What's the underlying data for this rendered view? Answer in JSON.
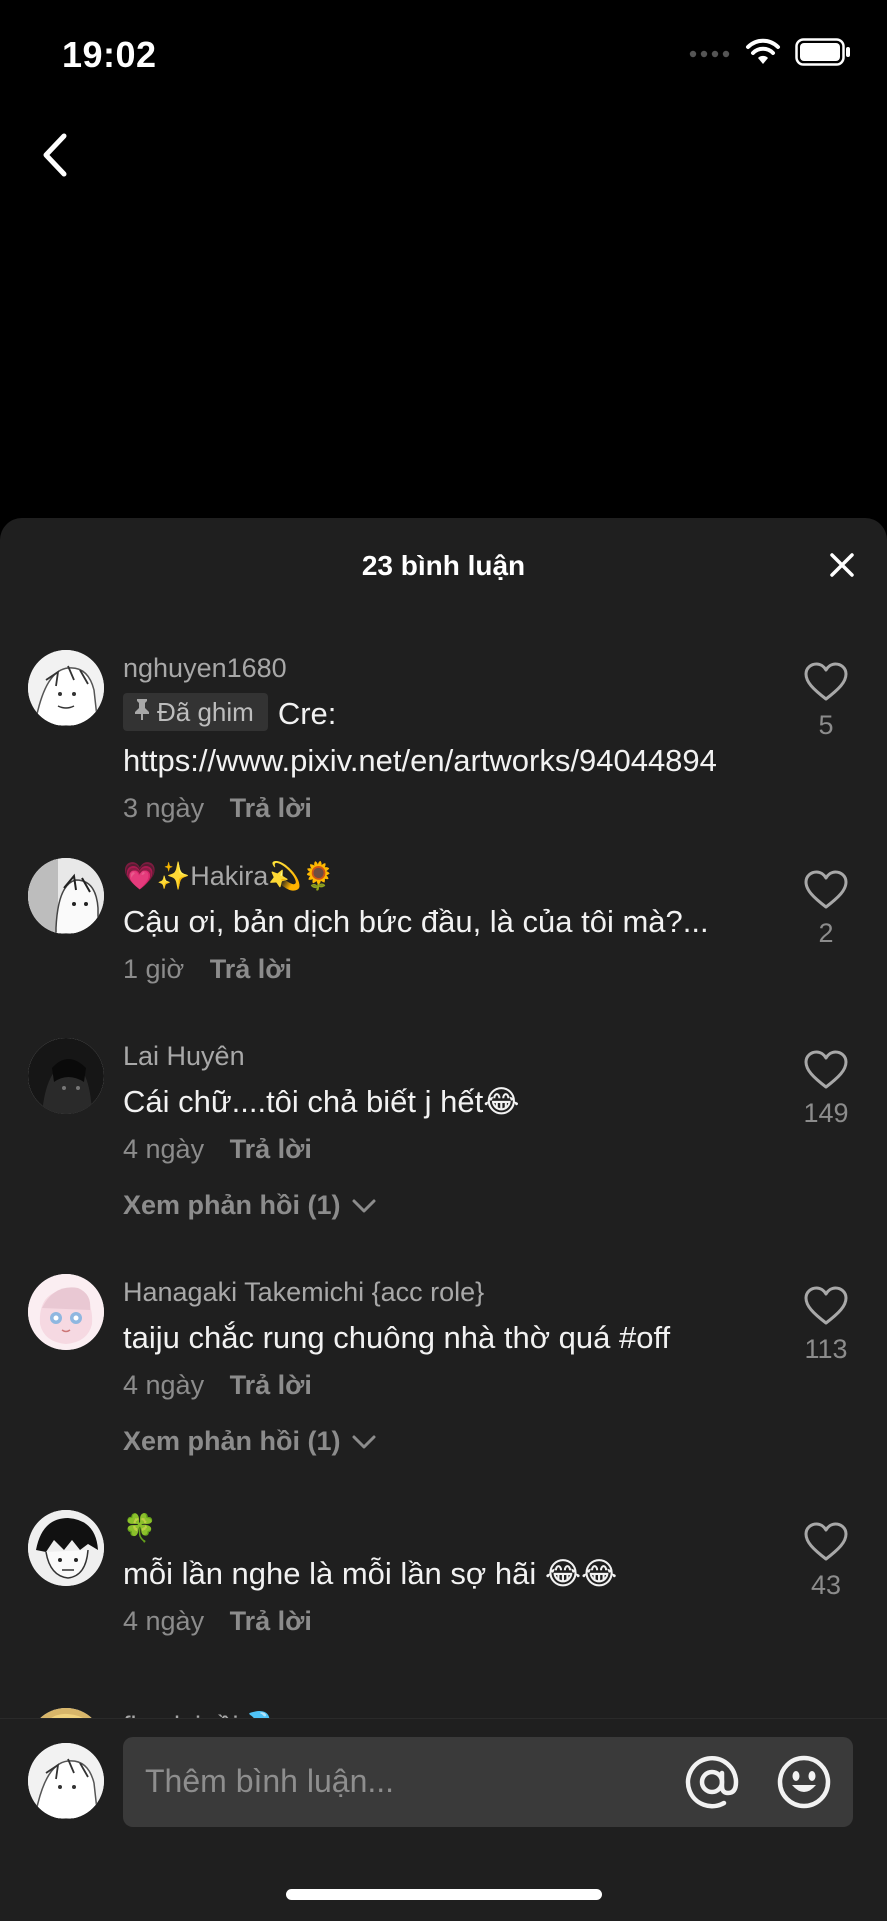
{
  "status": {
    "time": "19:02",
    "icons": [
      "signal-icon",
      "wifi-icon",
      "battery-icon"
    ]
  },
  "nav": {
    "back_icon": "chevron-left-icon"
  },
  "sheet": {
    "title": "23 bình luận",
    "close_icon": "close-icon"
  },
  "comments": [
    {
      "username": "nghuyen1680",
      "pinned_label": "Đã ghim",
      "text": "Cre: https://www.pixiv.net/en/artworks/94044894",
      "time": "3 ngày",
      "reply_label": "Trả lời",
      "likes": "5"
    },
    {
      "username": "💗✨Hakira💫🌻",
      "text": "Cậu ơi, bản dịch bức đầu, là của tôi mà?...",
      "time": "1 giờ",
      "reply_label": "Trả lời",
      "likes": "2"
    },
    {
      "username": "Lai Huyên",
      "text": "Cái chữ....tôi chả biết j hết😂",
      "time": "4 ngày",
      "reply_label": "Trả lời",
      "likes": "149",
      "view_replies": "Xem phản hồi (1)"
    },
    {
      "username": "Hanagaki Takemichi {acc role}",
      "text": "taiju chắc rung chuông nhà thờ quá #off",
      "time": "4 ngày",
      "reply_label": "Trả lời",
      "likes": "113",
      "view_replies": "Xem phản hồi (1)"
    },
    {
      "username": "🍀",
      "text": "mỗi lần nghe là mỗi lần sợ hãi 😂😂",
      "time": "4 ngày",
      "reply_label": "Trả lời",
      "likes": "43"
    },
    {
      "username": "flop lại rồi💦",
      "text": "",
      "likes": ""
    }
  ],
  "input": {
    "placeholder": "Thêm bình luận...",
    "icons": [
      "at-sign-icon",
      "emoji-icon"
    ]
  },
  "colors": {
    "background": "#000000",
    "sheet": "#1f1f1f",
    "input_box": "#3a3a3a",
    "secondary_text": "#8c8c8c"
  }
}
